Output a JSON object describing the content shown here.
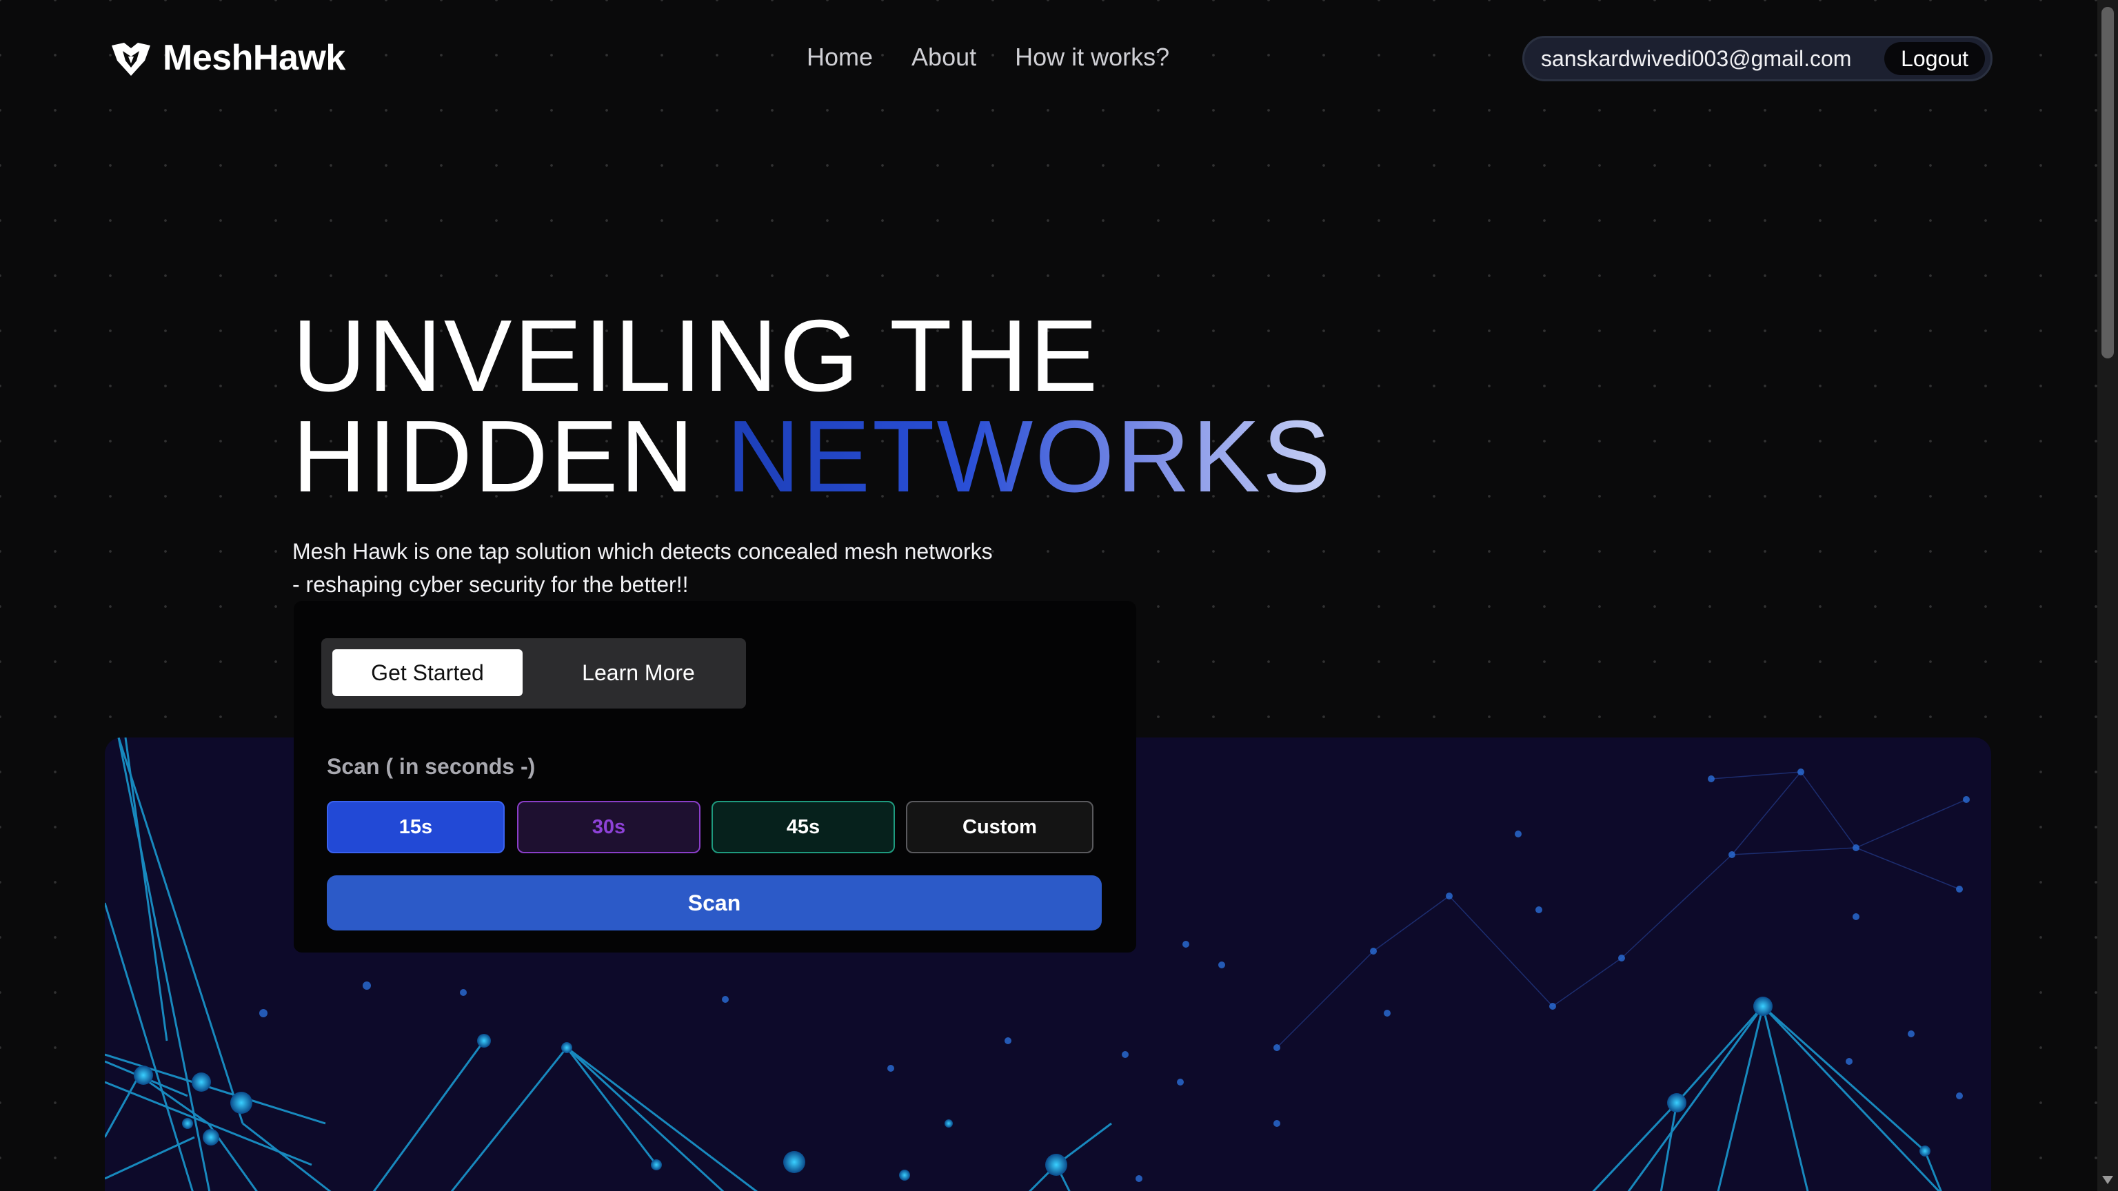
{
  "header": {
    "brand": "MeshHawk",
    "nav": [
      {
        "label": "Home"
      },
      {
        "label": "About"
      },
      {
        "label": "How it works?"
      }
    ],
    "user_email": "sanskardwivedi003@gmail.com",
    "logout_label": "Logout"
  },
  "hero": {
    "title_line1": "UNVEILING THE",
    "title_line2_plain": "HIDDEN",
    "title_line2_accent": "NETWORKS",
    "subtitle_line1": "Mesh Hawk is one tap solution which detects concealed mesh networks",
    "subtitle_line2": "- reshaping cyber security for the better!!"
  },
  "scan_card": {
    "get_started_label": "Get Started",
    "learn_more_label": "Learn More",
    "scan_duration_label": "Scan ( in seconds -)",
    "durations": [
      {
        "label": "15s",
        "color": "#2249d6"
      },
      {
        "label": "30s",
        "color": "#8e42d8"
      },
      {
        "label": "45s",
        "color": "#1e9a7e"
      },
      {
        "label": "Custom",
        "color": "#5a5a5e"
      }
    ],
    "scan_button_label": "Scan"
  },
  "theme": {
    "background": "#0a0a0b",
    "accent_blue": "#2c5ac8",
    "banner_background": "#0d0a2a"
  },
  "icons": {
    "logo": "hawk-shield-icon",
    "scroll_down": "chevron-down-icon"
  }
}
